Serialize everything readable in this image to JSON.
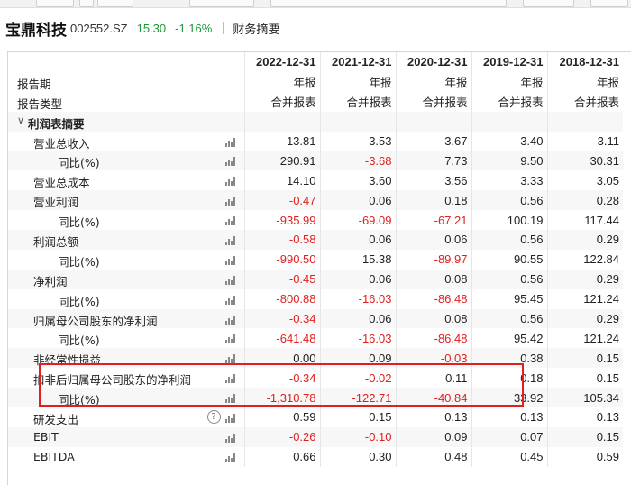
{
  "stock": {
    "name": "宝鼎科技",
    "code": "002552.SZ",
    "price": "15.30",
    "change": "-1.16%",
    "tab": "财务摘要"
  },
  "table": {
    "dates": [
      "2022-12-31",
      "2021-12-31",
      "2020-12-31",
      "2019-12-31",
      "2018-12-31"
    ],
    "period_label": "报告期",
    "period_values": [
      "年报",
      "年报",
      "年报",
      "年报",
      "年报"
    ],
    "type_label": "报告类型",
    "type_values": [
      "合并报表",
      "合并报表",
      "合并报表",
      "合并报表",
      "合并报表"
    ],
    "section": "利润表摘要",
    "rows": [
      {
        "label": "营业总收入",
        "indent": 1,
        "values": [
          "13.81",
          "3.53",
          "3.67",
          "3.40",
          "3.11"
        ]
      },
      {
        "label": "同比(%)",
        "indent": 2,
        "values": [
          "290.91",
          "-3.68",
          "7.73",
          "9.50",
          "30.31"
        ]
      },
      {
        "label": "营业总成本",
        "indent": 1,
        "values": [
          "14.10",
          "3.60",
          "3.56",
          "3.33",
          "3.05"
        ]
      },
      {
        "label": "营业利润",
        "indent": 1,
        "values": [
          "-0.47",
          "0.06",
          "0.18",
          "0.56",
          "0.28"
        ]
      },
      {
        "label": "同比(%)",
        "indent": 2,
        "values": [
          "-935.99",
          "-69.09",
          "-67.21",
          "100.19",
          "117.44"
        ]
      },
      {
        "label": "利润总额",
        "indent": 1,
        "values": [
          "-0.58",
          "0.06",
          "0.06",
          "0.56",
          "0.29"
        ]
      },
      {
        "label": "同比(%)",
        "indent": 2,
        "values": [
          "-990.50",
          "15.38",
          "-89.97",
          "90.55",
          "122.84"
        ]
      },
      {
        "label": "净利润",
        "indent": 1,
        "values": [
          "-0.45",
          "0.06",
          "0.08",
          "0.56",
          "0.29"
        ]
      },
      {
        "label": "同比(%)",
        "indent": 2,
        "values": [
          "-800.88",
          "-16.03",
          "-86.48",
          "95.45",
          "121.24"
        ]
      },
      {
        "label": "归属母公司股东的净利润",
        "indent": 1,
        "values": [
          "-0.34",
          "0.06",
          "0.08",
          "0.56",
          "0.29"
        ]
      },
      {
        "label": "同比(%)",
        "indent": 2,
        "values": [
          "-641.48",
          "-16.03",
          "-86.48",
          "95.42",
          "121.24"
        ]
      },
      {
        "label": "非经常性损益",
        "indent": 1,
        "values": [
          "0.00",
          "0.09",
          "-0.03",
          "0.38",
          "0.15"
        ]
      },
      {
        "label": "扣非后归属母公司股东的净利润",
        "indent": 1,
        "values": [
          "-0.34",
          "-0.02",
          "0.11",
          "0.18",
          "0.15"
        ]
      },
      {
        "label": "同比(%)",
        "indent": 2,
        "values": [
          "-1,310.78",
          "-122.71",
          "-40.84",
          "33.92",
          "105.34"
        ]
      },
      {
        "label": "研发支出",
        "indent": 1,
        "help": true,
        "values": [
          "0.59",
          "0.15",
          "0.13",
          "0.13",
          "0.13"
        ]
      },
      {
        "label": "EBIT",
        "indent": 1,
        "values": [
          "-0.26",
          "-0.10",
          "0.09",
          "0.07",
          "0.15"
        ]
      },
      {
        "label": "EBITDA",
        "indent": 1,
        "values": [
          "0.66",
          "0.30",
          "0.48",
          "0.45",
          "0.59"
        ]
      }
    ]
  },
  "colors": {
    "negative": "#e02020",
    "price_down": "#1a9a36",
    "highlight_box": "#e02020"
  },
  "icons": {
    "row_chart": "bar-chart-icon",
    "help": "question-circle-icon",
    "collapse": "chevron-down-icon"
  }
}
